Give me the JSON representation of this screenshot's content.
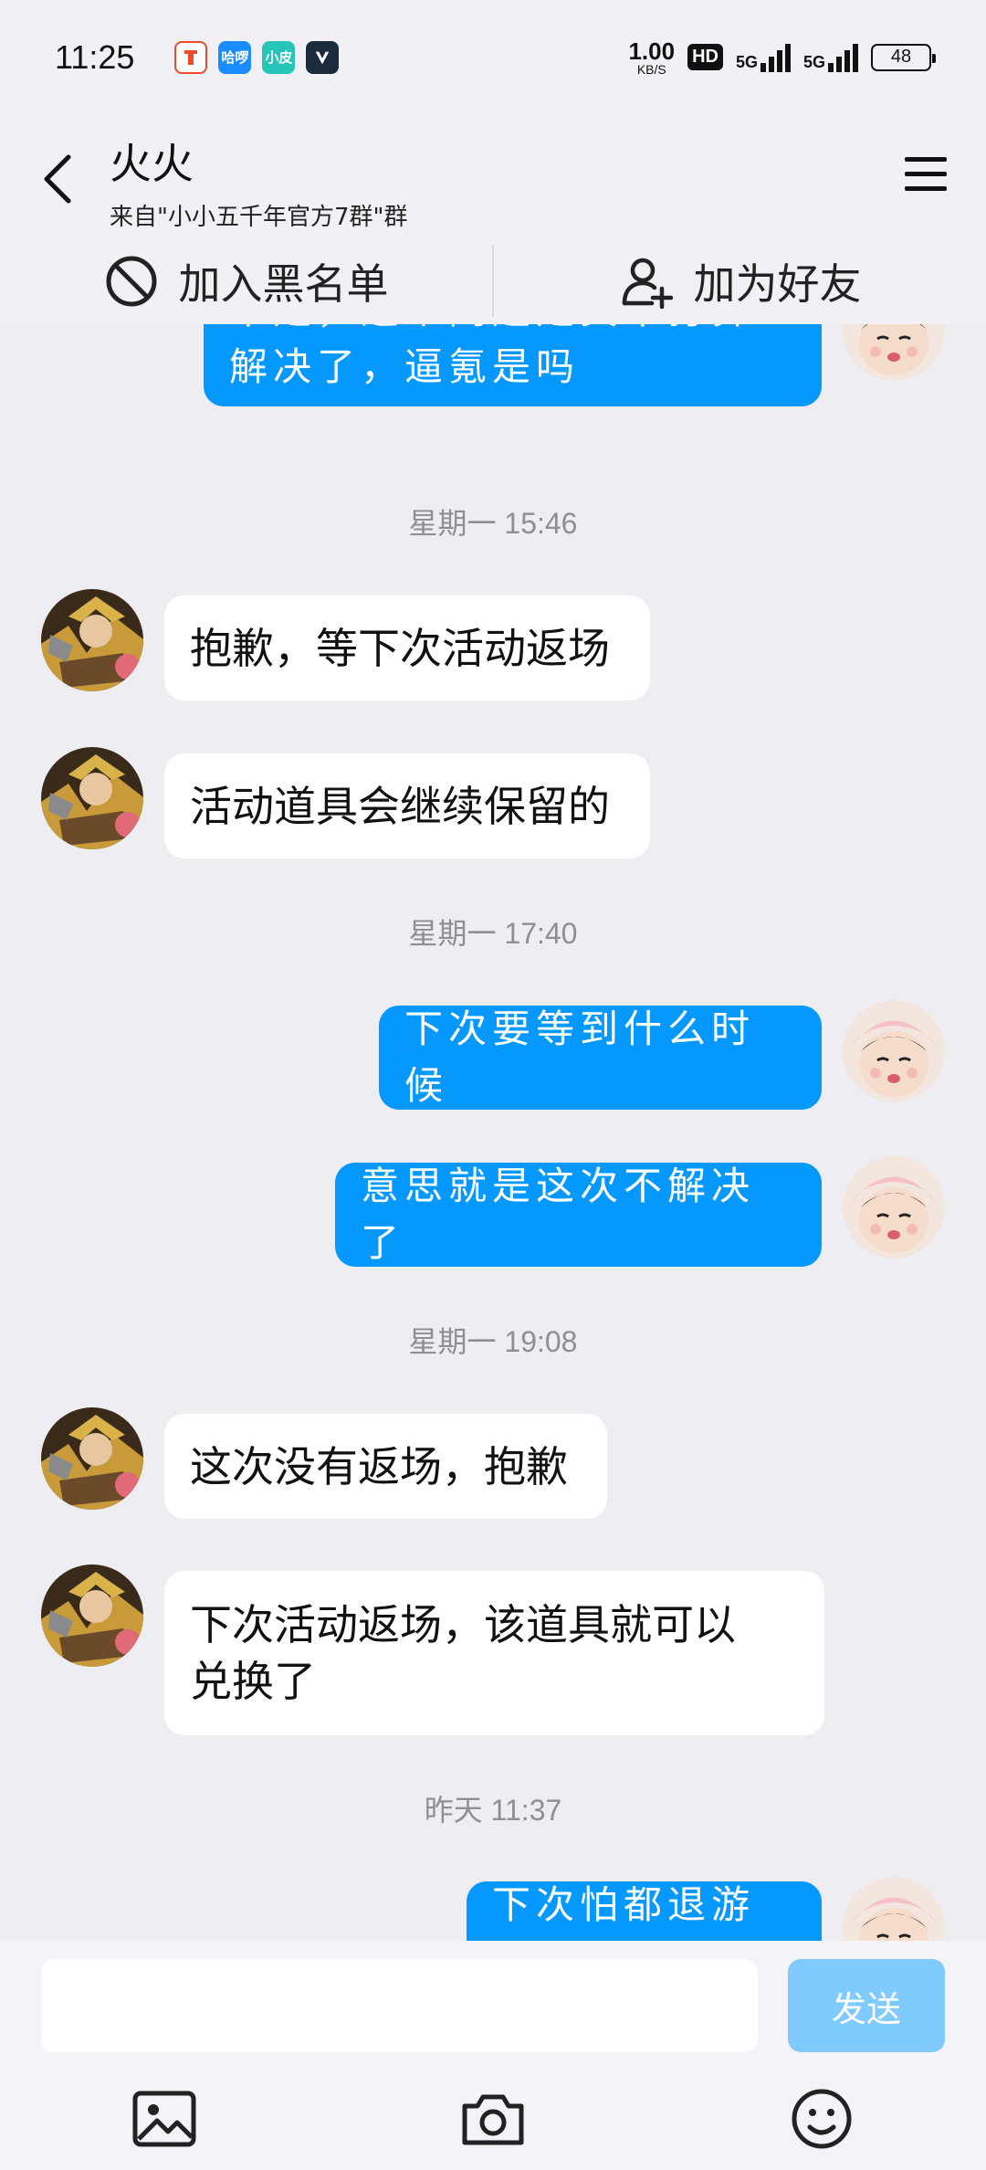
{
  "status_bar": {
    "time": "11:25",
    "net_speed_value": "1.00",
    "net_speed_unit": "KB/S",
    "hd_label": "HD",
    "network_1": "5G",
    "network_2": "5G",
    "battery": "48",
    "notification_icons": [
      "app-icon-red",
      "app-icon-blue-haluo",
      "app-icon-teal-xiaopi",
      "app-icon-dark-v"
    ],
    "notification_labels": [
      "",
      "哈啰",
      "小皮",
      ""
    ]
  },
  "header": {
    "title": "火火",
    "subtitle": "来自\"小小五千年官方7群\"群"
  },
  "actions": {
    "blacklist_label": "加入黑名单",
    "add_friend_label": "加为好友"
  },
  "messages": {
    "m0": "不是，这个问题是真不打算解决了，逼氪是吗",
    "ts1": "星期一 15:46",
    "m1": "抱歉，等下次活动返场",
    "m2": "活动道具会继续保留的",
    "ts2": "星期一 17:40",
    "m3": "下次要等到什么时候",
    "m4": "意思就是这次不解决了",
    "ts3": "星期一 19:08",
    "m5": "这次没有返场，抱歉",
    "m6": "下次活动返场，该道具就可以兑换了",
    "ts4": "昨天 11:37",
    "m7": "下次怕都退游了"
  },
  "input": {
    "placeholder": "",
    "send_label": "发送"
  },
  "colors": {
    "outgoing_bubble": "#0598ff",
    "incoming_bubble": "#ffffff",
    "send_button_disabled": "#7fcbff",
    "background": "#eeeef2"
  }
}
